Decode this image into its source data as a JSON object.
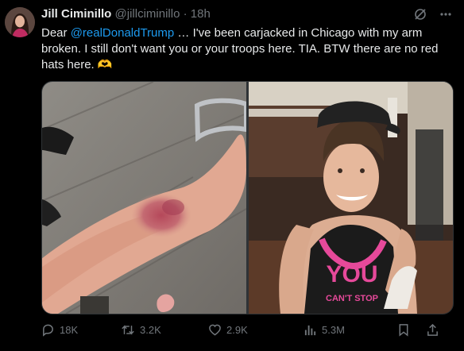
{
  "author": {
    "name": "Jill Ciminillo",
    "handle": "@jillciminillo",
    "separator": "·",
    "time": "18h"
  },
  "tweet": {
    "text_prefix": "Dear ",
    "mention": "@realDonaldTrump",
    "text_suffix": " … I've been carjacked in Chicago with my arm broken. I still don't want you or your troops here. TIA. BTW there are no red hats here. ",
    "emoji": "🫶"
  },
  "media": {
    "left_image": "injured-forearm-photo",
    "right_image": "woman-selfie-photo",
    "shirt_text_1": "YOU",
    "shirt_text_2": "CAN'T STOP"
  },
  "actions": {
    "replies": "18K",
    "reposts": "3.2K",
    "likes": "2.9K",
    "views": "5.3M"
  },
  "icons": {
    "grok": "grok-icon",
    "more": "more-icon",
    "reply": "reply-icon",
    "repost": "repost-icon",
    "like": "heart-icon",
    "views": "views-icon",
    "bookmark": "bookmark-icon",
    "share": "share-icon"
  },
  "colors": {
    "background": "#000000",
    "text": "#e7e9ea",
    "muted": "#71767b",
    "link": "#1d9bf0"
  }
}
